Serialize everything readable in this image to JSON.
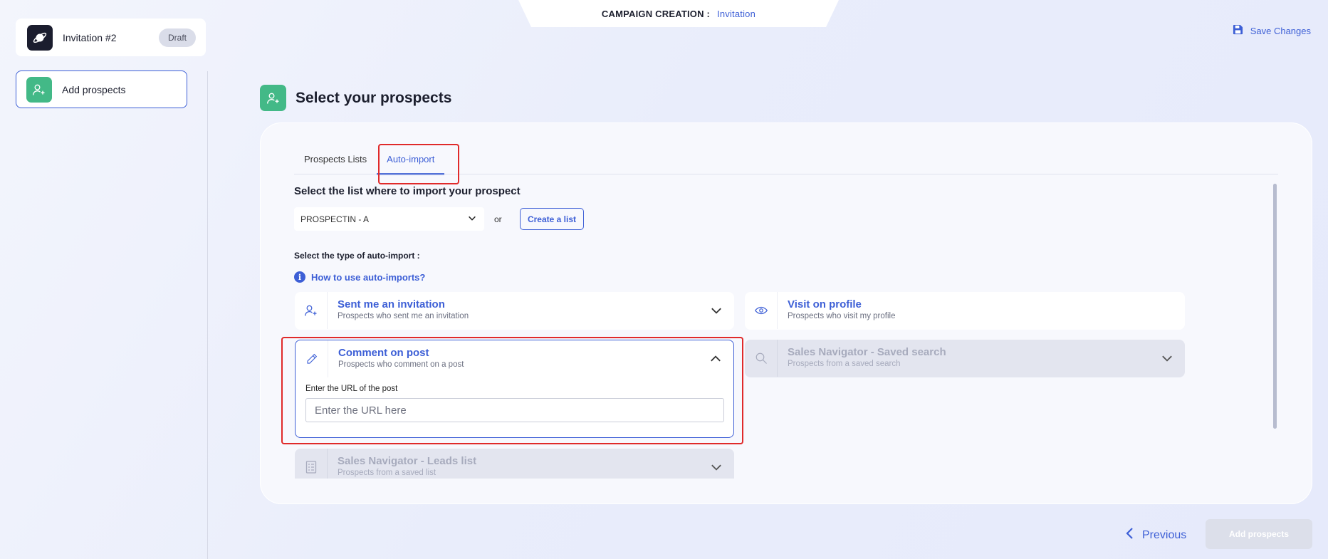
{
  "header": {
    "label": "CAMPAIGN CREATION :",
    "value": "Invitation",
    "save_label": "Save Changes"
  },
  "sidebar": {
    "campaign_name": "Invitation #2",
    "campaign_status": "Draft",
    "steps": [
      {
        "label": "Add prospects",
        "icon": "user-plus-icon"
      }
    ]
  },
  "main": {
    "title": "Select your prospects",
    "tabs": [
      {
        "label": "Prospects Lists",
        "active": false
      },
      {
        "label": "Auto-import",
        "active": true
      }
    ],
    "list_section_label": "Select the list where to import your prospect",
    "selected_list": "PROSPECTIN - A",
    "or_text": "or",
    "create_list_label": "Create a list",
    "type_label": "Select the type of auto-import :",
    "help_link": "How to use auto-imports?",
    "import_types": [
      {
        "title": "Sent me an invitation",
        "subtitle": "Prospects who sent me an invitation",
        "icon": "user-plus-icon",
        "state": "collapsed"
      },
      {
        "title": "Visit on profile",
        "subtitle": "Prospects who visit my profile",
        "icon": "eye-icon",
        "state": "plain"
      },
      {
        "title": "Comment on post",
        "subtitle": "Prospects who comment on a post",
        "icon": "pencil-icon",
        "state": "expanded"
      },
      {
        "title": "Sales Navigator - Saved search",
        "subtitle": "Prospects from a saved search",
        "icon": "search-icon",
        "state": "disabled"
      },
      {
        "title": "Sales Navigator - Leads list",
        "subtitle": "Prospects from a saved list",
        "icon": "list-icon",
        "state": "disabled"
      }
    ],
    "url_field": {
      "label": "Enter the URL of the post",
      "placeholder": "Enter the URL here",
      "value": ""
    }
  },
  "footer": {
    "previous_label": "Previous",
    "add_label": "Add prospects"
  },
  "colors": {
    "accent": "#3d5fd6",
    "green": "#43b987",
    "highlight": "#e02a2a"
  }
}
